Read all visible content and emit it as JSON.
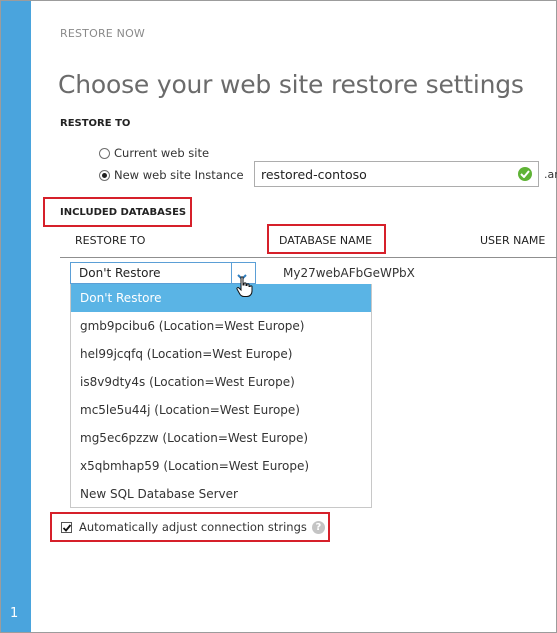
{
  "step": {
    "number": "1"
  },
  "header": {
    "eyebrow": "RESTORE NOW",
    "title": "Choose your web site restore settings"
  },
  "restore_to": {
    "label": "RESTORE TO",
    "options": [
      {
        "label": "Current web site",
        "checked": false
      },
      {
        "label": "New web site Instance",
        "checked": true
      }
    ],
    "instance_name": "restored-contoso",
    "instance_valid": true,
    "domain_suffix": ".ar"
  },
  "databases": {
    "label": "INCLUDED DATABASES",
    "columns": [
      "RESTORE TO",
      "DATABASE NAME",
      "USER NAME"
    ],
    "row": {
      "restore_to_value": "Don't Restore",
      "database_name": "My27webAFbGeWPbX"
    },
    "dropdown_options": [
      {
        "label": "Don't Restore",
        "selected": true
      },
      {
        "label": "gmb9pcibu6 (Location=West Europe)",
        "selected": false
      },
      {
        "label": "hel99jcqfq (Location=West Europe)",
        "selected": false
      },
      {
        "label": "is8v9dty4s (Location=West Europe)",
        "selected": false
      },
      {
        "label": "mc5le5u44j (Location=West Europe)",
        "selected": false
      },
      {
        "label": "mg5ec6pzzw (Location=West Europe)",
        "selected": false
      },
      {
        "label": "x5qbmhap59 (Location=West Europe)",
        "selected": false
      },
      {
        "label": "New SQL Database Server",
        "selected": false
      }
    ]
  },
  "auto_adjust": {
    "label": "Automatically adjust connection strings",
    "checked": true,
    "help_symbol": "?"
  },
  "colors": {
    "accent": "#4aa4dd",
    "selection": "#5ab4e5",
    "highlight_border": "#d6202a",
    "valid_check": "#5fb336"
  },
  "icons": [
    "radio-button",
    "check-circle-icon",
    "chevron-down-icon",
    "hand-cursor-icon",
    "checkbox-check-icon",
    "help-icon"
  ]
}
